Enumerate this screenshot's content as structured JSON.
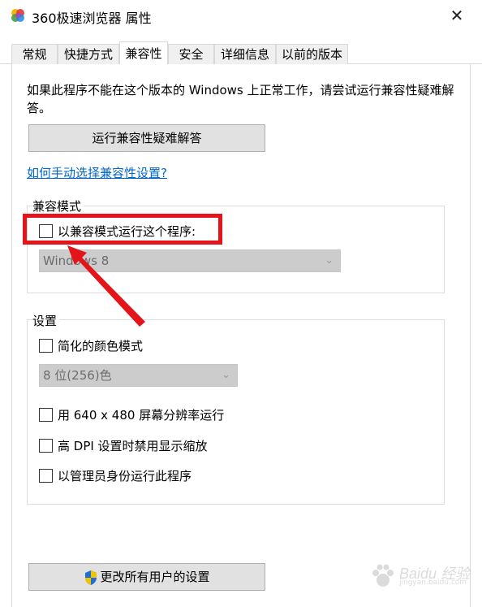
{
  "window": {
    "title": "360极速浏览器 属性",
    "close_glyph": "✕"
  },
  "tabs": [
    {
      "label": "常规"
    },
    {
      "label": "快捷方式"
    },
    {
      "label": "兼容性"
    },
    {
      "label": "安全"
    },
    {
      "label": "详细信息"
    },
    {
      "label": "以前的版本"
    }
  ],
  "compat": {
    "description": "如果此程序不能在这个版本的 Windows 上正常工作，请尝试运行兼容性疑难解答。",
    "run_troubleshooter_label": "运行兼容性疑难解答",
    "help_link": "如何手动选择兼容性设置?",
    "mode_group_label": "兼容模式",
    "mode_checkbox_label": "以兼容模式运行这个程序:",
    "mode_checked": false,
    "os_select_value": "Windows 8",
    "settings_group_label": "设置",
    "reduced_color_label": "简化的颜色模式",
    "color_select_value": "8 位(256)色",
    "res_640_label": "用 640 x 480 屏幕分辨率运行",
    "dpi_label": "高 DPI 设置时禁用显示缩放",
    "admin_label": "以管理员身份运行此程序",
    "all_users_button": "更改所有用户的设置"
  },
  "watermark": {
    "brand": "Baidu",
    "cn": "经验",
    "sub": "jingyan.baidu.com"
  },
  "colors": {
    "highlight": "#e3141a",
    "link": "#0066cc"
  }
}
